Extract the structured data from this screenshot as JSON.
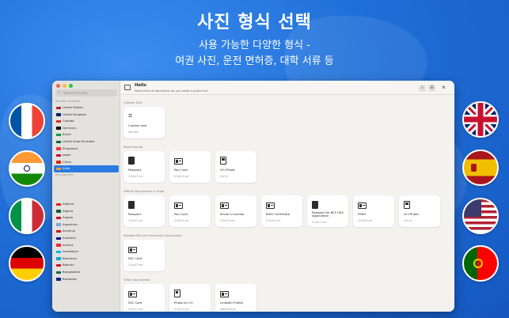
{
  "headline": {
    "title": "사진 형식 선택",
    "line1": "사용 가능한 다양한 형식 -",
    "line2": "여권 사진, 운전 면허증, 대학 서류 등"
  },
  "flags_left": [
    "France",
    "India",
    "Italy",
    "Germany"
  ],
  "flags_right": [
    "United Kingdom",
    "Spain",
    "United States",
    "Portugal"
  ],
  "sidebar": {
    "search_placeholder": "Search Country",
    "popular_header": "Popular countries",
    "popular": [
      {
        "label": "United States",
        "color": "#b22234"
      },
      {
        "label": "United Kingdom",
        "color": "#012169"
      },
      {
        "label": "Canada",
        "color": "#d52b1e"
      },
      {
        "label": "Germany",
        "color": "#000000"
      },
      {
        "label": "Brazil",
        "color": "#009c3b"
      },
      {
        "label": "United Arab Emirates",
        "color": "#00732f"
      },
      {
        "label": "Singapore",
        "color": "#ef3340"
      },
      {
        "label": "Japan",
        "color": "#bc002d"
      },
      {
        "label": "China",
        "color": "#de2910"
      },
      {
        "label": "India",
        "color": "#ff9933",
        "selected": true
      }
    ],
    "all_header": "All countries",
    "all": [
      {
        "label": "Albania",
        "color": "#e41e20"
      },
      {
        "label": "Algeria",
        "color": "#006233"
      },
      {
        "label": "Angola",
        "color": "#cc092f"
      },
      {
        "label": "Argentina",
        "color": "#74acdf"
      },
      {
        "label": "Armenia",
        "color": "#d90012"
      },
      {
        "label": "Australia",
        "color": "#00008b"
      },
      {
        "label": "Austria",
        "color": "#ed2939"
      },
      {
        "label": "Azerbaijan",
        "color": "#00b5e2"
      },
      {
        "label": "Bahamas",
        "color": "#00abc9"
      },
      {
        "label": "Bahrain",
        "color": "#ce1126"
      },
      {
        "label": "Bangladesh",
        "color": "#006a4e"
      },
      {
        "label": "Barbados",
        "color": "#00267f"
      }
    ]
  },
  "topbar": {
    "title": "Hello",
    "subtitle": "What kind of document do you need a photo for?"
  },
  "sections": {
    "custom": "Custom Size",
    "popular": "Most Popular",
    "official": "Official Documents in India",
    "student": "Student IDs and University Documents",
    "other": "Other Documents"
  },
  "custom_card": {
    "name": "Custom size",
    "size": "Set size"
  },
  "popular_cards": [
    {
      "name": "Passport",
      "size": "3.5x4.5 cm",
      "icon": "passport-icon"
    },
    {
      "name": "Pan Card",
      "size": "2.5x3.5 cm",
      "icon": "id-card-icon"
    },
    {
      "name": "OCI Photo",
      "size": "2x2 in",
      "icon": "oci-icon"
    }
  ],
  "official_cards": [
    {
      "name": "Passport",
      "size": "3.5x4.5 cm",
      "icon": "passport-icon"
    },
    {
      "name": "Pan Card",
      "size": "2.5x3.5 cm",
      "icon": "id-card-icon"
    },
    {
      "name": "Driver's License",
      "size": "3.5x4.5 cm",
      "icon": "id-card-icon"
    },
    {
      "name": "Birth Certificate",
      "size": "3.5x4.5 cm",
      "icon": "id-card-icon"
    },
    {
      "name": "Passport for BLS USA Application",
      "size": "5.1x5.1 cm",
      "icon": "passport-icon"
    },
    {
      "name": "FRRO",
      "size": "3.5x4.5 cm",
      "icon": "id-card-icon"
    },
    {
      "name": "OCI Photo",
      "size": "2x2 in",
      "icon": "oci-icon"
    }
  ],
  "student_cards": [
    {
      "name": "ISIC Card",
      "size": "3.5x4.5 cm",
      "icon": "id-card-icon"
    }
  ],
  "other_cards": [
    {
      "name": "ISIC Card",
      "size": "3.5x4.5 cm",
      "icon": "id-card-icon"
    },
    {
      "name": "Photo for CV",
      "size": "3.5x4.5 cm",
      "icon": "cv-icon"
    },
    {
      "name": "LinkedIn Profile",
      "size": "400x400 px",
      "icon": "linkedin-icon"
    }
  ]
}
